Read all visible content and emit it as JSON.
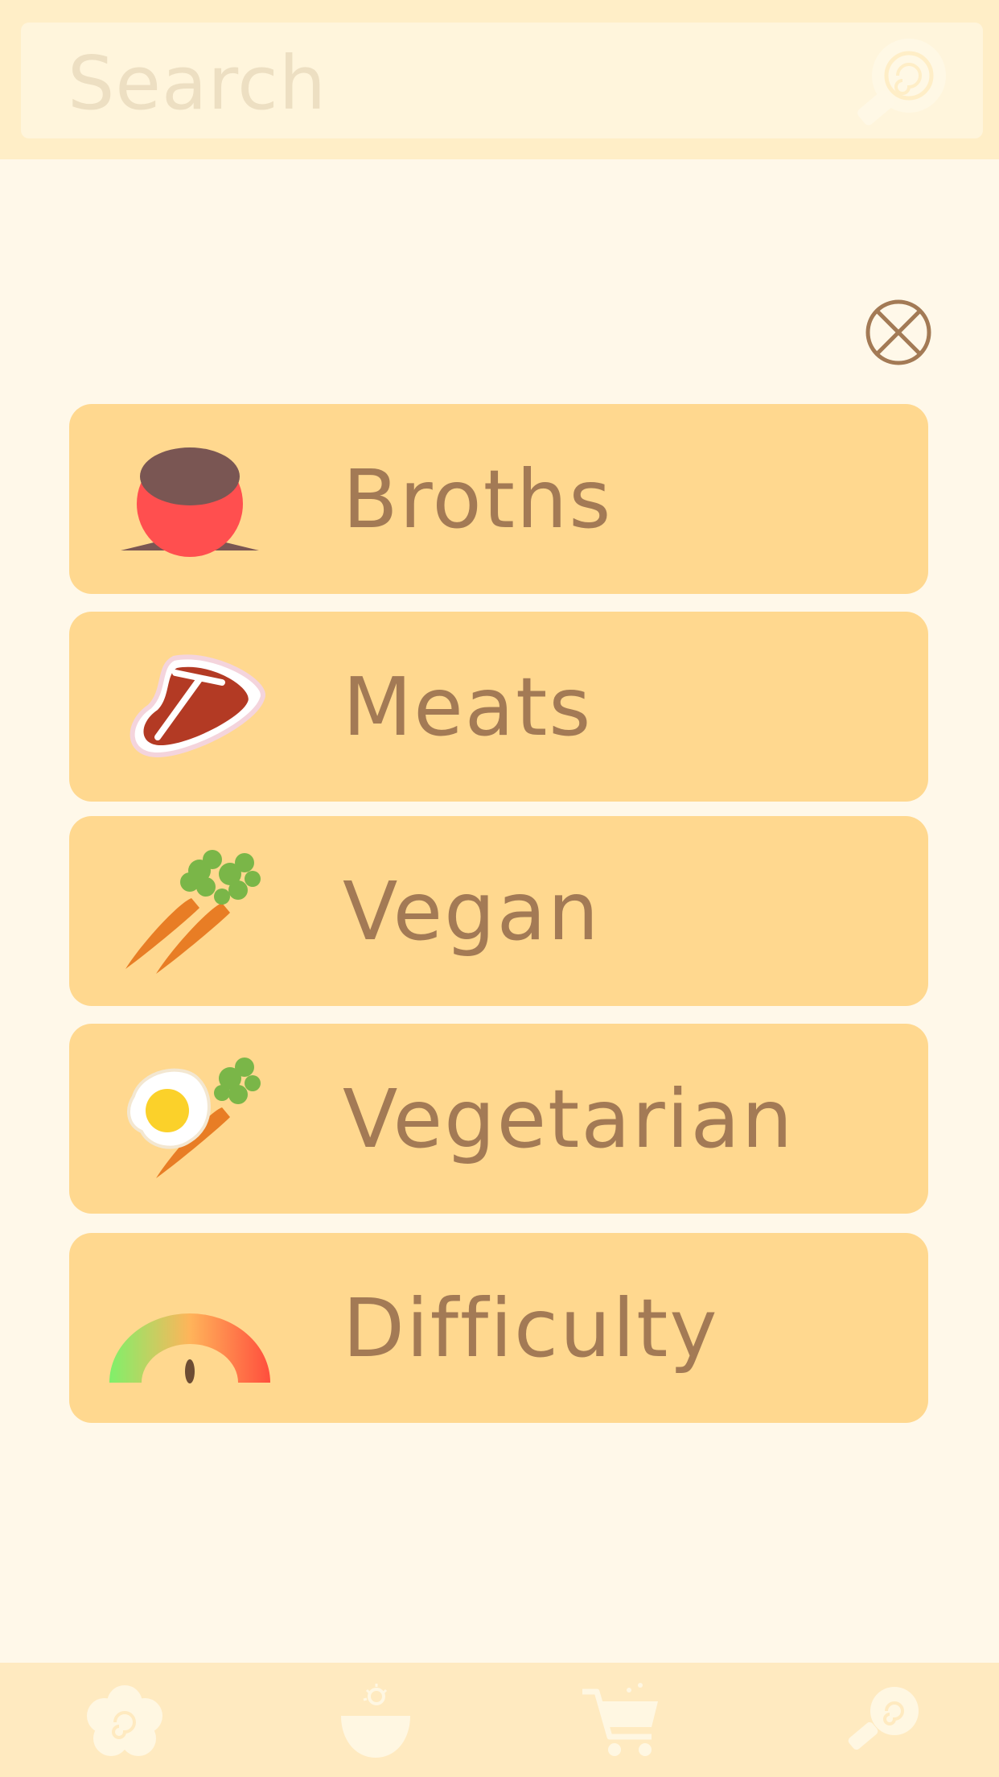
{
  "search": {
    "placeholder": "Search",
    "icon": "search-icon"
  },
  "close": {
    "icon": "close-circle-icon"
  },
  "categories": [
    {
      "label": "Broths",
      "icon": "broth-pot-icon"
    },
    {
      "label": "Meats",
      "icon": "steak-icon"
    },
    {
      "label": "Vegan",
      "icon": "carrots-icon"
    },
    {
      "label": "Vegetarian",
      "icon": "egg-carrot-icon"
    },
    {
      "label": "Difficulty",
      "icon": "gauge-icon"
    }
  ],
  "tabbar": {
    "items": [
      {
        "icon": "flower-swirl-icon"
      },
      {
        "icon": "bowl-icon"
      },
      {
        "icon": "cart-icon"
      },
      {
        "icon": "search-icon"
      }
    ]
  },
  "colors": {
    "background": "#fff8e9",
    "card": "#ffd88f",
    "label": "#a37a55",
    "search_bar": "#ffeec7",
    "tabbar": "#ffeac0"
  }
}
